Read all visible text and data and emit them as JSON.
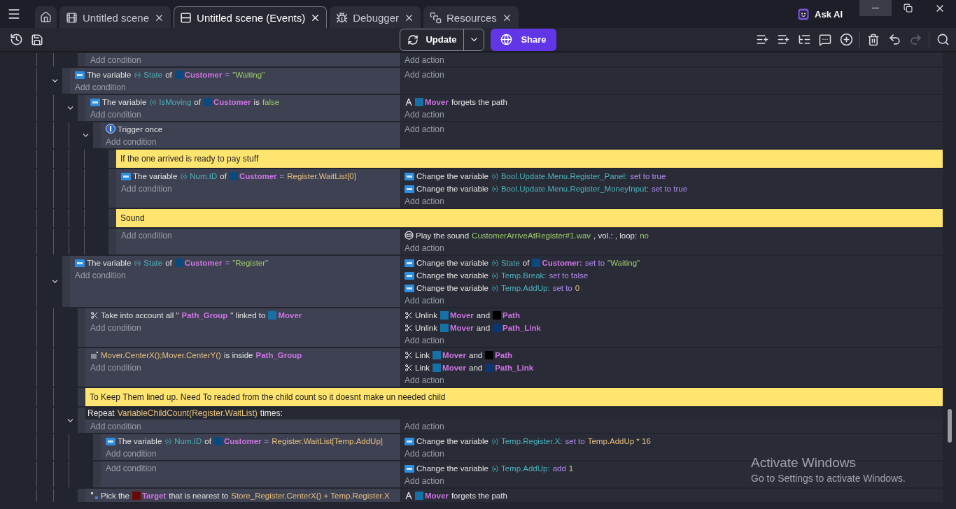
{
  "tabs": [
    {
      "kind": "scene",
      "label": "Untitled scene",
      "selected": false
    },
    {
      "kind": "events",
      "label": "Untitled scene (Events)",
      "selected": true
    },
    {
      "kind": "debugger",
      "label": "Debugger",
      "selected": false
    },
    {
      "kind": "resources",
      "label": "Resources",
      "selected": false
    }
  ],
  "ask_ai": "Ask AI",
  "toolbar": {
    "update": "Update",
    "share": "Share",
    "redo": {
      "disabled": true
    }
  },
  "events": [
    {
      "children": [
        {
          "kind": "standard",
          "add_condition": "Add condition",
          "add_action": "Add action"
        }
      ]
    },
    {
      "kind": "standard",
      "expanded": true,
      "add_condition": "Add condition",
      "add_action": "Add action",
      "conditions": [
        {
          "kind": "variable",
          "parts": [
            {
              "kind": "text",
              "t": "The variable"
            },
            {
              "kind": "var",
              "t": "State"
            },
            {
              "kind": "text",
              "t": "of"
            },
            {
              "kind": "object",
              "t": "Customer",
              "color": "#0b4a7e"
            },
            {
              "kind": "op",
              "t": "="
            },
            {
              "kind": "string",
              "t": "\"Waiting\""
            }
          ]
        }
      ],
      "children": [
        {
          "kind": "standard",
          "expanded": true,
          "add_condition": "Add condition",
          "add_action": "Add action",
          "conditions": [
            {
              "kind": "variable",
              "parts": [
                {
                  "kind": "text",
                  "t": "The variable"
                },
                {
                  "kind": "var",
                  "t": "IsMoving"
                },
                {
                  "kind": "text",
                  "t": "of"
                },
                {
                  "kind": "object",
                  "t": "Customer",
                  "color": "#0b4a7e"
                },
                {
                  "kind": "text",
                  "t": "is"
                },
                {
                  "kind": "string",
                  "t": "false"
                }
              ]
            }
          ],
          "actions": [
            {
              "kind": "pathfinding",
              "parts": [
                {
                  "kind": "object",
                  "t": "Mover",
                  "color": "#1571a6"
                },
                {
                  "kind": "text",
                  "t": "forgets the path"
                }
              ]
            }
          ],
          "children": [
            {
              "kind": "standard",
              "expanded": true,
              "add_condition": "Add condition",
              "add_action": "Add action",
              "conditions": [
                {
                  "kind": "trigger",
                  "parts": [
                    {
                      "kind": "text",
                      "t": "Trigger once"
                    }
                  ]
                }
              ],
              "children": [
                {
                  "kind": "comment",
                  "text": "If the one arrived is ready to pay stuff"
                },
                {
                  "kind": "standard",
                  "add_condition": "Add condition",
                  "add_action": "Add action",
                  "conditions": [
                    {
                      "kind": "variable",
                      "parts": [
                        {
                          "kind": "text",
                          "t": "The variable"
                        },
                        {
                          "kind": "var",
                          "t": "Num.ID"
                        },
                        {
                          "kind": "text",
                          "t": "of"
                        },
                        {
                          "kind": "object",
                          "t": "Customer",
                          "color": "#0b4a7e"
                        },
                        {
                          "kind": "op",
                          "t": "="
                        },
                        {
                          "kind": "expr",
                          "t": "Register.WaitList[0]"
                        }
                      ]
                    }
                  ],
                  "actions": [
                    {
                      "kind": "variable",
                      "parts": [
                        {
                          "kind": "text",
                          "t": "Change the variable"
                        },
                        {
                          "kind": "var",
                          "t": "Bool.Update.Menu.Register_Panel:"
                        },
                        {
                          "kind": "op",
                          "t": "set to true"
                        }
                      ]
                    },
                    {
                      "kind": "variable",
                      "parts": [
                        {
                          "kind": "text",
                          "t": "Change the variable"
                        },
                        {
                          "kind": "var",
                          "t": "Bool.Update.Menu.Register_MoneyInput:"
                        },
                        {
                          "kind": "op",
                          "t": "set to true"
                        }
                      ]
                    }
                  ]
                },
                {
                  "kind": "comment",
                  "text": "Sound"
                },
                {
                  "kind": "standard",
                  "add_condition": "Add condition",
                  "add_action": "Add action",
                  "actions": [
                    {
                      "kind": "sound",
                      "parts": [
                        {
                          "kind": "text",
                          "t": "Play the sound"
                        },
                        {
                          "kind": "string",
                          "t": "CustomerArriveAtRegister#1.wav"
                        },
                        {
                          "kind": "text",
                          "t": ", vol.: , loop:"
                        },
                        {
                          "kind": "string",
                          "t": "no"
                        }
                      ]
                    }
                  ]
                }
              ]
            }
          ]
        }
      ]
    },
    {
      "kind": "standard",
      "expanded": true,
      "add_condition": "Add condition",
      "add_action": "Add action",
      "conditions": [
        {
          "kind": "variable",
          "parts": [
            {
              "kind": "text",
              "t": "The variable"
            },
            {
              "kind": "var",
              "t": "State"
            },
            {
              "kind": "text",
              "t": "of"
            },
            {
              "kind": "object",
              "t": "Customer",
              "color": "#0b4a7e"
            },
            {
              "kind": "op",
              "t": "="
            },
            {
              "kind": "string",
              "t": "\"Register\""
            }
          ]
        }
      ],
      "actions": [
        {
          "kind": "variable",
          "parts": [
            {
              "kind": "text",
              "t": "Change the variable"
            },
            {
              "kind": "var",
              "t": "State"
            },
            {
              "kind": "text",
              "t": "of"
            },
            {
              "kind": "object",
              "t": "Customer:",
              "color": "#0b4a7e"
            },
            {
              "kind": "op",
              "t": "set to"
            },
            {
              "kind": "string",
              "t": "\"Waiting\""
            }
          ]
        },
        {
          "kind": "variable",
          "parts": [
            {
              "kind": "text",
              "t": "Change the variable"
            },
            {
              "kind": "var",
              "t": "Temp.Break:"
            },
            {
              "kind": "op",
              "t": "set to false"
            }
          ]
        },
        {
          "kind": "variable",
          "parts": [
            {
              "kind": "text",
              "t": "Change the variable"
            },
            {
              "kind": "var",
              "t": "Temp.AddUp:"
            },
            {
              "kind": "op",
              "t": "set to"
            },
            {
              "kind": "expr",
              "t": "0"
            }
          ]
        }
      ],
      "children": [
        {
          "kind": "standard",
          "add_condition": "Add condition",
          "add_action": "Add action",
          "conditions": [
            {
              "kind": "link",
              "parts": [
                {
                  "kind": "text",
                  "t": "Take into account all \""
                },
                {
                  "kind": "object",
                  "t": "Path_Group"
                },
                {
                  "kind": "text",
                  "t": "\" linked to"
                },
                {
                  "kind": "object",
                  "t": "Mover",
                  "color": "#1571a6"
                }
              ]
            }
          ],
          "actions": [
            {
              "kind": "link",
              "parts": [
                {
                  "kind": "text",
                  "t": "Unlink"
                },
                {
                  "kind": "object",
                  "t": "Mover",
                  "color": "#1571a6"
                },
                {
                  "kind": "text",
                  "t": "and"
                },
                {
                  "kind": "object",
                  "t": "Path",
                  "color": "#000000"
                }
              ]
            },
            {
              "kind": "link",
              "parts": [
                {
                  "kind": "text",
                  "t": "Unlink"
                },
                {
                  "kind": "object",
                  "t": "Mover",
                  "color": "#1571a6"
                },
                {
                  "kind": "text",
                  "t": "and"
                },
                {
                  "kind": "object",
                  "t": "Path_Link",
                  "color": "#0a3774"
                }
              ]
            }
          ]
        },
        {
          "kind": "standard",
          "add_condition": "Add condition",
          "add_action": "Add action",
          "conditions": [
            {
              "kind": "position",
              "parts": [
                {
                  "kind": "expr",
                  "t": "Mover.CenterX();Mover.CenterY()"
                },
                {
                  "kind": "text",
                  "t": "is inside"
                },
                {
                  "kind": "object",
                  "t": "Path_Group"
                }
              ]
            }
          ],
          "actions": [
            {
              "kind": "link",
              "parts": [
                {
                  "kind": "text",
                  "t": "Link"
                },
                {
                  "kind": "object",
                  "t": "Mover",
                  "color": "#1571a6"
                },
                {
                  "kind": "text",
                  "t": "and"
                },
                {
                  "kind": "object",
                  "t": "Path",
                  "color": "#000000"
                }
              ]
            },
            {
              "kind": "link",
              "parts": [
                {
                  "kind": "text",
                  "t": "Link"
                },
                {
                  "kind": "object",
                  "t": "Mover",
                  "color": "#1571a6"
                },
                {
                  "kind": "text",
                  "t": "and"
                },
                {
                  "kind": "object",
                  "t": "Path_Link",
                  "color": "#0a3774"
                }
              ]
            }
          ]
        },
        {
          "kind": "comment",
          "text": "To Keep Them lined up. Need To readed from the child count so it doesnt make un needed child"
        },
        {
          "kind": "repeat",
          "expanded": true,
          "add_condition": "Add condition",
          "add_action": "Add action",
          "header": [
            {
              "kind": "text",
              "t": "Repeat"
            },
            {
              "kind": "expr",
              "t": "VariableChildCount(Register.WaitList)"
            },
            {
              "kind": "text",
              "t": "times:"
            }
          ],
          "children": [
            {
              "kind": "standard",
              "add_condition": "Add condition",
              "add_action": "Add action",
              "conditions": [
                {
                  "kind": "variable",
                  "parts": [
                    {
                      "kind": "text",
                      "t": "The variable"
                    },
                    {
                      "kind": "var",
                      "t": "Num.ID"
                    },
                    {
                      "kind": "text",
                      "t": "of"
                    },
                    {
                      "kind": "object",
                      "t": "Customer",
                      "color": "#0b4a7e"
                    },
                    {
                      "kind": "op",
                      "t": "="
                    },
                    {
                      "kind": "expr",
                      "t": "Register.WaitList[Temp.AddUp]"
                    }
                  ]
                }
              ],
              "actions": [
                {
                  "kind": "variable",
                  "parts": [
                    {
                      "kind": "text",
                      "t": "Change the variable"
                    },
                    {
                      "kind": "var",
                      "t": "Temp.Register.X:"
                    },
                    {
                      "kind": "op",
                      "t": "set to"
                    },
                    {
                      "kind": "expr",
                      "t": "Temp.AddUp * 16"
                    }
                  ]
                }
              ]
            },
            {
              "kind": "standard",
              "add_condition": "Add condition",
              "add_action": "Add action",
              "actions": [
                {
                  "kind": "variable",
                  "parts": [
                    {
                      "kind": "text",
                      "t": "Change the variable"
                    },
                    {
                      "kind": "var",
                      "t": "Temp.AddUp:"
                    },
                    {
                      "kind": "op",
                      "t": "add"
                    },
                    {
                      "kind": "expr",
                      "t": "1"
                    }
                  ]
                }
              ]
            }
          ]
        },
        {
          "kind": "standard",
          "conditions": [
            {
              "kind": "pick",
              "parts": [
                {
                  "kind": "text",
                  "t": "Pick the"
                },
                {
                  "kind": "object",
                  "t": "Target",
                  "color": "#6a0909"
                },
                {
                  "kind": "text",
                  "t": "that is nearest to"
                },
                {
                  "kind": "expr",
                  "t": "Store_Register.CenterX() + Temp.Register.X"
                }
              ]
            }
          ],
          "actions": [
            {
              "kind": "pathfinding",
              "parts": [
                {
                  "kind": "object",
                  "t": "Mover",
                  "color": "#1571a6"
                },
                {
                  "kind": "text",
                  "t": "forgets the path"
                }
              ]
            }
          ]
        }
      ]
    }
  ],
  "os_notice": {
    "title": "Activate Windows",
    "subtitle": "Go to Settings to activate Windows."
  }
}
